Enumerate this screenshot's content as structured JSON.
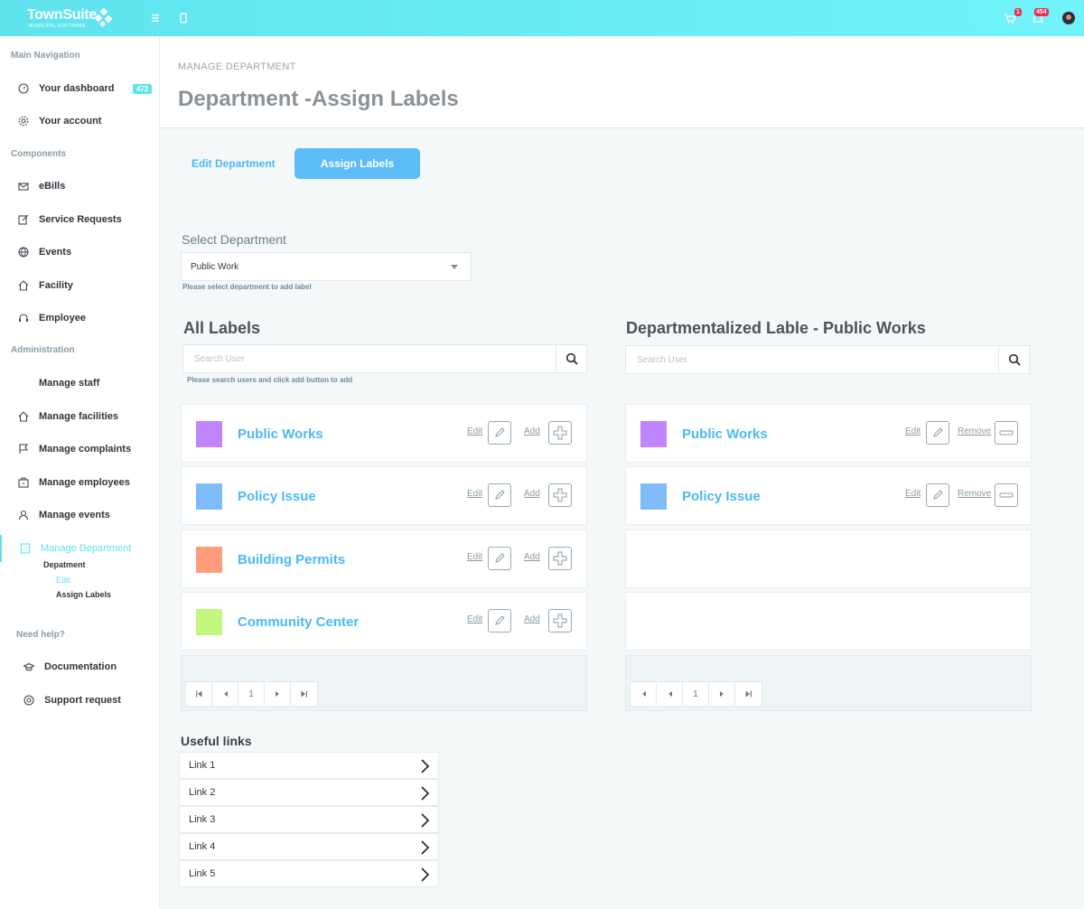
{
  "topbar": {
    "logo_name": "TownSuite",
    "logo_sub": "MUNICIPAL SOFTWARE",
    "badge_cart": "1",
    "badge_notifications": "454"
  },
  "sidebar": {
    "sections": [
      "Main Navigation",
      "Components",
      "Administration",
      "Need help?"
    ],
    "main": [
      {
        "label": "Your dashboard",
        "count": "472",
        "icon": "gauge-icon"
      },
      {
        "label": "Your account",
        "icon": "gear-icon"
      }
    ],
    "components": [
      {
        "label": "eBills",
        "icon": "envelope-icon"
      },
      {
        "label": "Service Requests",
        "icon": "edit-icon"
      },
      {
        "label": "Events",
        "icon": "globe-icon"
      },
      {
        "label": "Facility",
        "icon": "home-icon"
      },
      {
        "label": "Employee",
        "icon": "headset-icon"
      }
    ],
    "admin": [
      {
        "label": "Manage staff",
        "icon": ""
      },
      {
        "label": "Manage facilities",
        "icon": "home-icon"
      },
      {
        "label": "Manage complaints",
        "icon": "flag-icon"
      },
      {
        "label": "Manage employees",
        "icon": "briefcase-icon"
      },
      {
        "label": "Manage events",
        "icon": "person-icon"
      },
      {
        "label": "Manage Department",
        "icon": "building-icon"
      }
    ],
    "sub": {
      "department": "Depatment",
      "edit": "Edit",
      "assign": "Assign Labels"
    },
    "help": [
      {
        "label": "Documentation",
        "icon": "graduation-cap-icon"
      },
      {
        "label": "Support request",
        "icon": "lifebuoy-icon"
      }
    ]
  },
  "header": {
    "breadcrumb": "MANAGE DEPARTMENT",
    "title": "Department -Assign Labels"
  },
  "tabs": {
    "edit": "Edit Department",
    "assign": "Assign Labels"
  },
  "select_department": {
    "label": "Select Department",
    "value": "Public Work",
    "hint": "Please select department to add label"
  },
  "all_labels": {
    "title": "All Labels",
    "search_placeholder": "Search User",
    "hint": "Please search users  and click add button to add",
    "edit_label": "Edit",
    "add_label": "Add",
    "items": [
      {
        "name": "Public  Works",
        "color": "#c084fc"
      },
      {
        "name": "Policy Issue",
        "color": "#7fbbf9"
      },
      {
        "name": "Building Permits",
        "color": "#fd9d7c"
      },
      {
        "name": "Community Center",
        "color": "#c2f77e"
      }
    ],
    "page": "1"
  },
  "dept_labels": {
    "title": "Departmentalized Lable - Public Works",
    "search_placeholder": "Search User",
    "edit_label": "Edit",
    "remove_label": "Remove",
    "items": [
      {
        "name": "Public  Works",
        "color": "#c084fc"
      },
      {
        "name": "Policy Issue",
        "color": "#7fbbf9"
      }
    ],
    "page": "1"
  },
  "useful_links": {
    "title": "Useful links",
    "items": [
      "Link 1",
      "Link 2",
      "Link 3",
      "Link 4",
      "Link 5"
    ]
  },
  "colors": {
    "accent": "#5ee3ee",
    "primary_button": "#5cbcf7",
    "link_blue": "#4cb8f5"
  }
}
